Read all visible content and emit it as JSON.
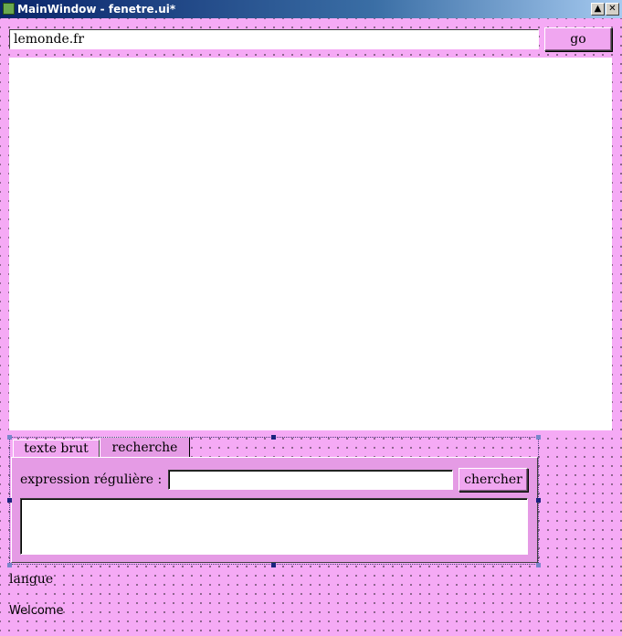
{
  "window": {
    "title": "MainWindow - fenetre.ui*",
    "minimize_glyph": "▲",
    "close_glyph": "✕"
  },
  "toolbar": {
    "url_value": "lemonde.fr",
    "go_label": "go"
  },
  "tabs": [
    {
      "label": "texte brut",
      "active": false
    },
    {
      "label": "recherche",
      "active": true
    }
  ],
  "search": {
    "regex_label": "expression régulière :",
    "regex_value": "",
    "search_button_label": "chercher",
    "results_value": ""
  },
  "footer": {
    "langue_label": "langue",
    "welcome_label": "Welcome"
  },
  "colors": {
    "background": "#f5aaf5",
    "titlebar_start": "#0a246a",
    "selection_handle": "#1a237e"
  },
  "icons": {
    "app_icon": "qt-designer-icon",
    "minimize": "minimize-icon",
    "close": "close-icon"
  }
}
